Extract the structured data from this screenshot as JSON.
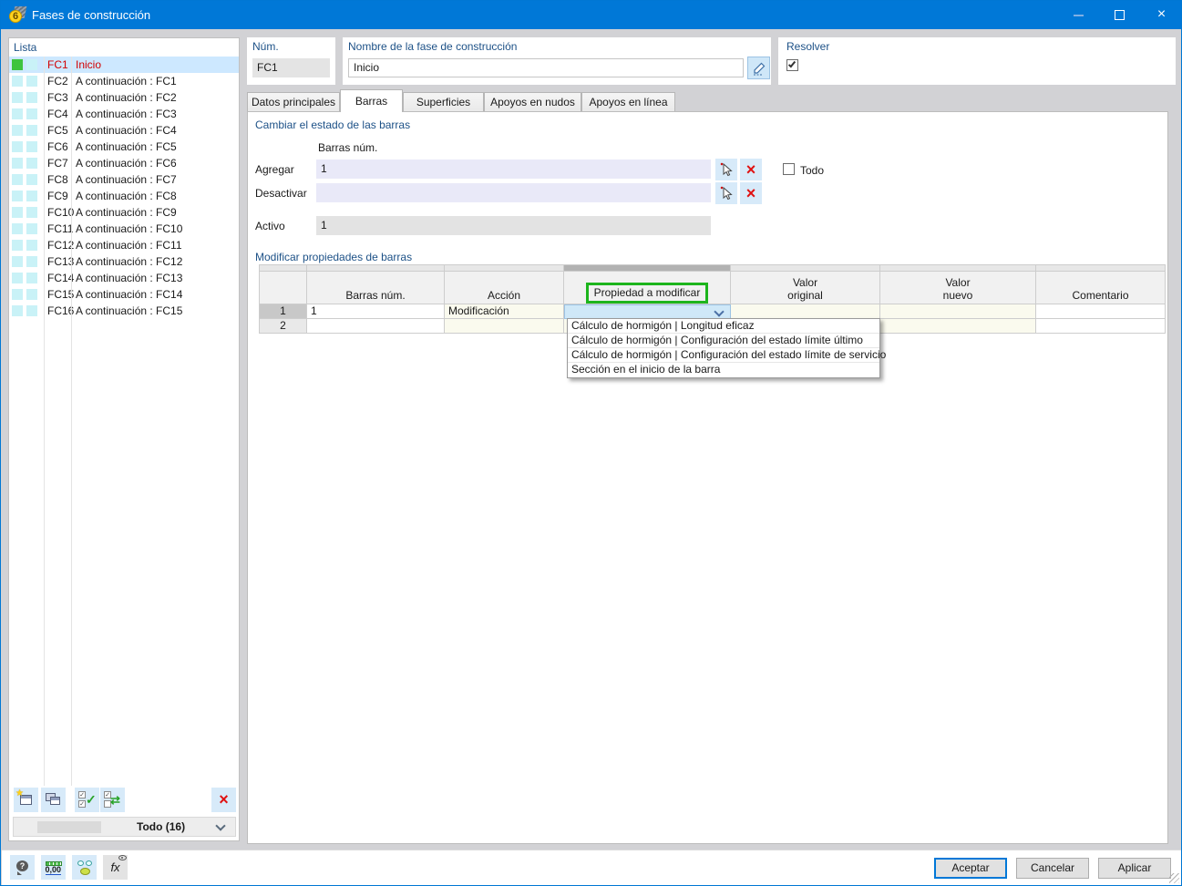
{
  "titlebar": {
    "title": "Fases de construcción"
  },
  "list": {
    "label": "Lista",
    "selected_index": 0,
    "items": [
      {
        "id": "FC1",
        "desc": "Inicio"
      },
      {
        "id": "FC2",
        "desc": "A continuación : FC1"
      },
      {
        "id": "FC3",
        "desc": "A continuación : FC2"
      },
      {
        "id": "FC4",
        "desc": "A continuación : FC3"
      },
      {
        "id": "FC5",
        "desc": "A continuación : FC4"
      },
      {
        "id": "FC6",
        "desc": "A continuación : FC5"
      },
      {
        "id": "FC7",
        "desc": "A continuación : FC6"
      },
      {
        "id": "FC8",
        "desc": "A continuación : FC7"
      },
      {
        "id": "FC9",
        "desc": "A continuación : FC8"
      },
      {
        "id": "FC10",
        "desc": "A continuación : FC9"
      },
      {
        "id": "FC11",
        "desc": "A continuación : FC10"
      },
      {
        "id": "FC12",
        "desc": "A continuación : FC11"
      },
      {
        "id": "FC13",
        "desc": "A continuación : FC12"
      },
      {
        "id": "FC14",
        "desc": "A continuación : FC13"
      },
      {
        "id": "FC15",
        "desc": "A continuación : FC14"
      },
      {
        "id": "FC16",
        "desc": "A continuación : FC15"
      }
    ],
    "filter_value": "Todo (16)"
  },
  "header": {
    "num_label": "Núm.",
    "num_value": "FC1",
    "name_label": "Nombre de la fase de construcción",
    "name_value": "Inicio",
    "solve_label": "Resolver",
    "solve_checked": true
  },
  "tabs": {
    "items": [
      {
        "label": "Datos principales"
      },
      {
        "label": "Barras",
        "active": true
      },
      {
        "label": "Superficies"
      },
      {
        "label": "Apoyos en nudos"
      },
      {
        "label": "Apoyos en línea"
      }
    ]
  },
  "bar_state": {
    "title": "Cambiar el estado de las barras",
    "column_header": "Barras núm.",
    "agregar_label": "Agregar",
    "agregar_value": "1",
    "desactivar_label": "Desactivar",
    "desactivar_value": "",
    "todo_label": "Todo",
    "todo_checked": false,
    "activo_label": "Activo",
    "activo_value": "1"
  },
  "modify": {
    "title": "Modificar propiedades de barras",
    "columns": {
      "barras": "Barras núm.",
      "accion": "Acción",
      "propiedad": "Propiedad a modificar",
      "valor_original_1": "Valor",
      "valor_original_2": "original",
      "valor_nuevo_1": "Valor",
      "valor_nuevo_2": "nuevo",
      "comentario": "Comentario"
    },
    "rows": [
      {
        "num": "1",
        "barras": "1",
        "accion": "Modificación",
        "propiedad": "",
        "valor_original": "",
        "valor_nuevo": "",
        "comentario": ""
      },
      {
        "num": "2",
        "barras": "",
        "accion": "",
        "propiedad": "",
        "valor_original": "",
        "valor_nuevo": "",
        "comentario": ""
      }
    ],
    "dropdown_options": [
      "Cálculo de hormigón | Longitud eficaz",
      "Cálculo de hormigón | Configuración del estado límite último",
      "Cálculo de hormigón | Configuración del estado límite de servicio",
      "Sección en el inicio de la barra"
    ]
  },
  "footer": {
    "units_text": "0,00",
    "fx_text": "fx",
    "accept": "Aceptar",
    "cancel": "Cancelar",
    "apply": "Aplicar"
  },
  "colors": {
    "titlebar": "#0078d7",
    "selection": "#cde8ff",
    "selected_text": "#d20000",
    "highlight_green": "#1db51d",
    "danger_red": "#e01111",
    "label_blue": "#1d5187"
  }
}
